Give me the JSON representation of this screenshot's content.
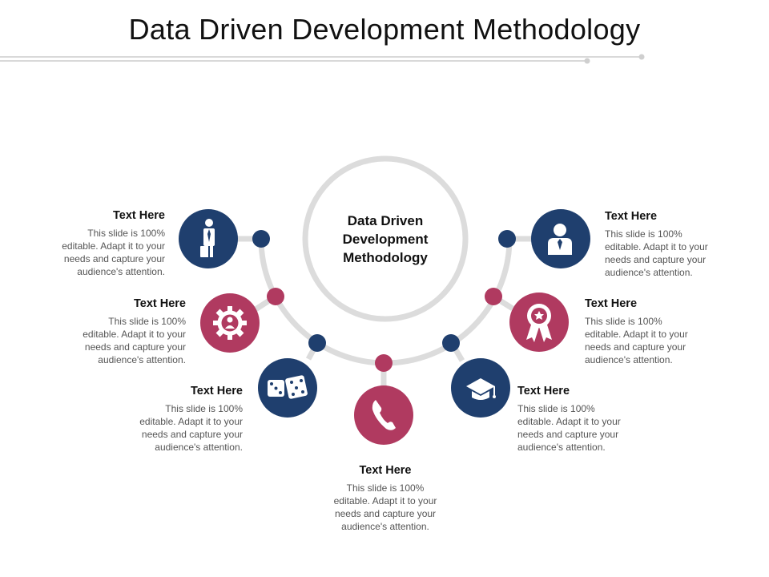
{
  "title": "Data Driven Development Methodology",
  "center": {
    "line1": "Data Driven",
    "line2": "Development",
    "line3": "Methodology"
  },
  "colors": {
    "navy": "#1f3f6e",
    "crimson": "#b03a60",
    "ring": "#dcdcdc"
  },
  "items": [
    {
      "heading": "Text Here",
      "lines": [
        "This slide is 100%",
        "editable. Adapt it to your",
        "needs and capture your",
        "audience's attention."
      ],
      "icon": "businessman-icon",
      "color": "navy"
    },
    {
      "heading": "Text Here",
      "lines": [
        "This slide is 100%",
        "editable. Adapt it to your",
        "needs and capture your",
        "audience's attention."
      ],
      "icon": "gear-person-icon",
      "color": "crimson"
    },
    {
      "heading": "Text Here",
      "lines": [
        "This slide is 100%",
        "editable. Adapt it to your",
        "needs and capture your",
        "audience's attention."
      ],
      "icon": "dice-icon",
      "color": "navy"
    },
    {
      "heading": "Text Here",
      "lines": [
        "This slide is 100%",
        "editable. Adapt it to your",
        "needs and capture your",
        "audience's attention."
      ],
      "icon": "phone-icon",
      "color": "crimson"
    },
    {
      "heading": "Text Here",
      "lines": [
        "This slide is 100%",
        "editable. Adapt it to your",
        "needs and capture your",
        "audience's attention."
      ],
      "icon": "graduation-cap-icon",
      "color": "navy"
    },
    {
      "heading": "Text Here",
      "lines": [
        "This slide is 100%",
        "editable. Adapt it to your",
        "needs and capture your",
        "audience's attention."
      ],
      "icon": "award-ribbon-icon",
      "color": "crimson"
    },
    {
      "heading": "Text Here",
      "lines": [
        "This slide is 100%",
        "editable. Adapt it to your",
        "needs and capture your",
        "audience's attention."
      ],
      "icon": "user-tie-icon",
      "color": "navy"
    }
  ]
}
